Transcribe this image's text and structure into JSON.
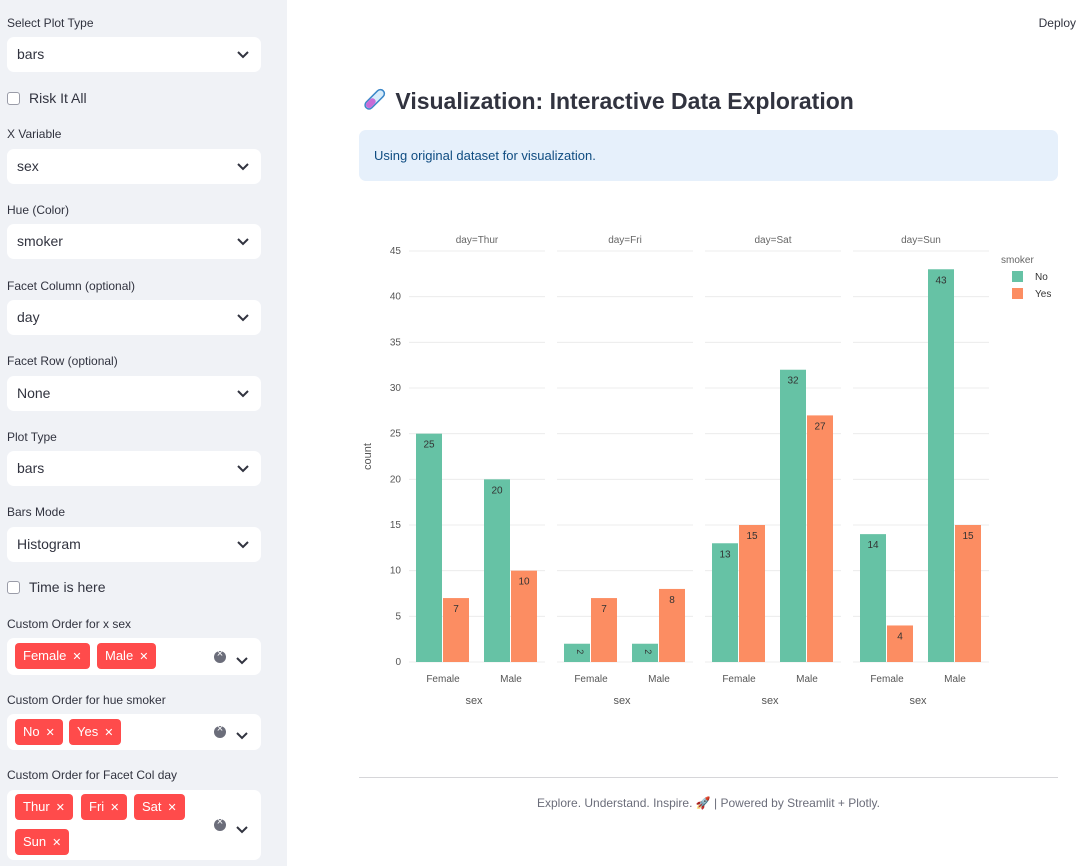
{
  "sidebar": {
    "plot_type": {
      "label": "Select Plot Type",
      "value": "bars"
    },
    "risk": {
      "label": "Risk It All"
    },
    "x_variable": {
      "label": "X Variable",
      "value": "sex"
    },
    "hue": {
      "label": "Hue (Color)",
      "value": "smoker"
    },
    "facet_col": {
      "label": "Facet Column (optional)",
      "value": "day"
    },
    "facet_row": {
      "label": "Facet Row (optional)",
      "value": "None"
    },
    "plot_type2": {
      "label": "Plot Type",
      "value": "bars"
    },
    "bars_mode": {
      "label": "Bars Mode",
      "value": "Histogram"
    },
    "time": {
      "label": "Time is here"
    },
    "order_x": {
      "label": "Custom Order for x sex",
      "tags": [
        "Female",
        "Male"
      ]
    },
    "order_hue": {
      "label": "Custom Order for hue smoker",
      "tags": [
        "No",
        "Yes"
      ]
    },
    "order_facet": {
      "label": "Custom Order for Facet Col day",
      "tags": [
        "Thur",
        "Fri",
        "Sat",
        "Sun"
      ]
    }
  },
  "header": {
    "deploy": "Deploy"
  },
  "main": {
    "title_icon": "test-tube-icon",
    "title": "Visualization: Interactive Data Exploration",
    "info": "Using original dataset for visualization."
  },
  "footer": {
    "text": "Explore. Understand. Inspire. 🚀 | Powered by Streamlit + Plotly."
  },
  "chart_data": {
    "type": "bar",
    "barmode": "group",
    "facet_titles": [
      "day=Thur",
      "day=Fri",
      "day=Sat",
      "day=Sun"
    ],
    "categories": [
      "Female",
      "Male"
    ],
    "xlabel": "sex",
    "ylabel": "count",
    "ylim": [
      0,
      45
    ],
    "yticks": [
      0,
      5,
      10,
      15,
      20,
      25,
      30,
      35,
      40,
      45
    ],
    "legend_title": "smoker",
    "legend_placement": "top-right",
    "series": [
      {
        "name": "No",
        "color": "#66c2a5",
        "values": [
          [
            25,
            20
          ],
          [
            2,
            2
          ],
          [
            13,
            32
          ],
          [
            14,
            43
          ]
        ]
      },
      {
        "name": "Yes",
        "color": "#fc8d62",
        "values": [
          [
            7,
            10
          ],
          [
            7,
            8
          ],
          [
            15,
            27
          ],
          [
            4,
            15
          ]
        ]
      }
    ]
  }
}
